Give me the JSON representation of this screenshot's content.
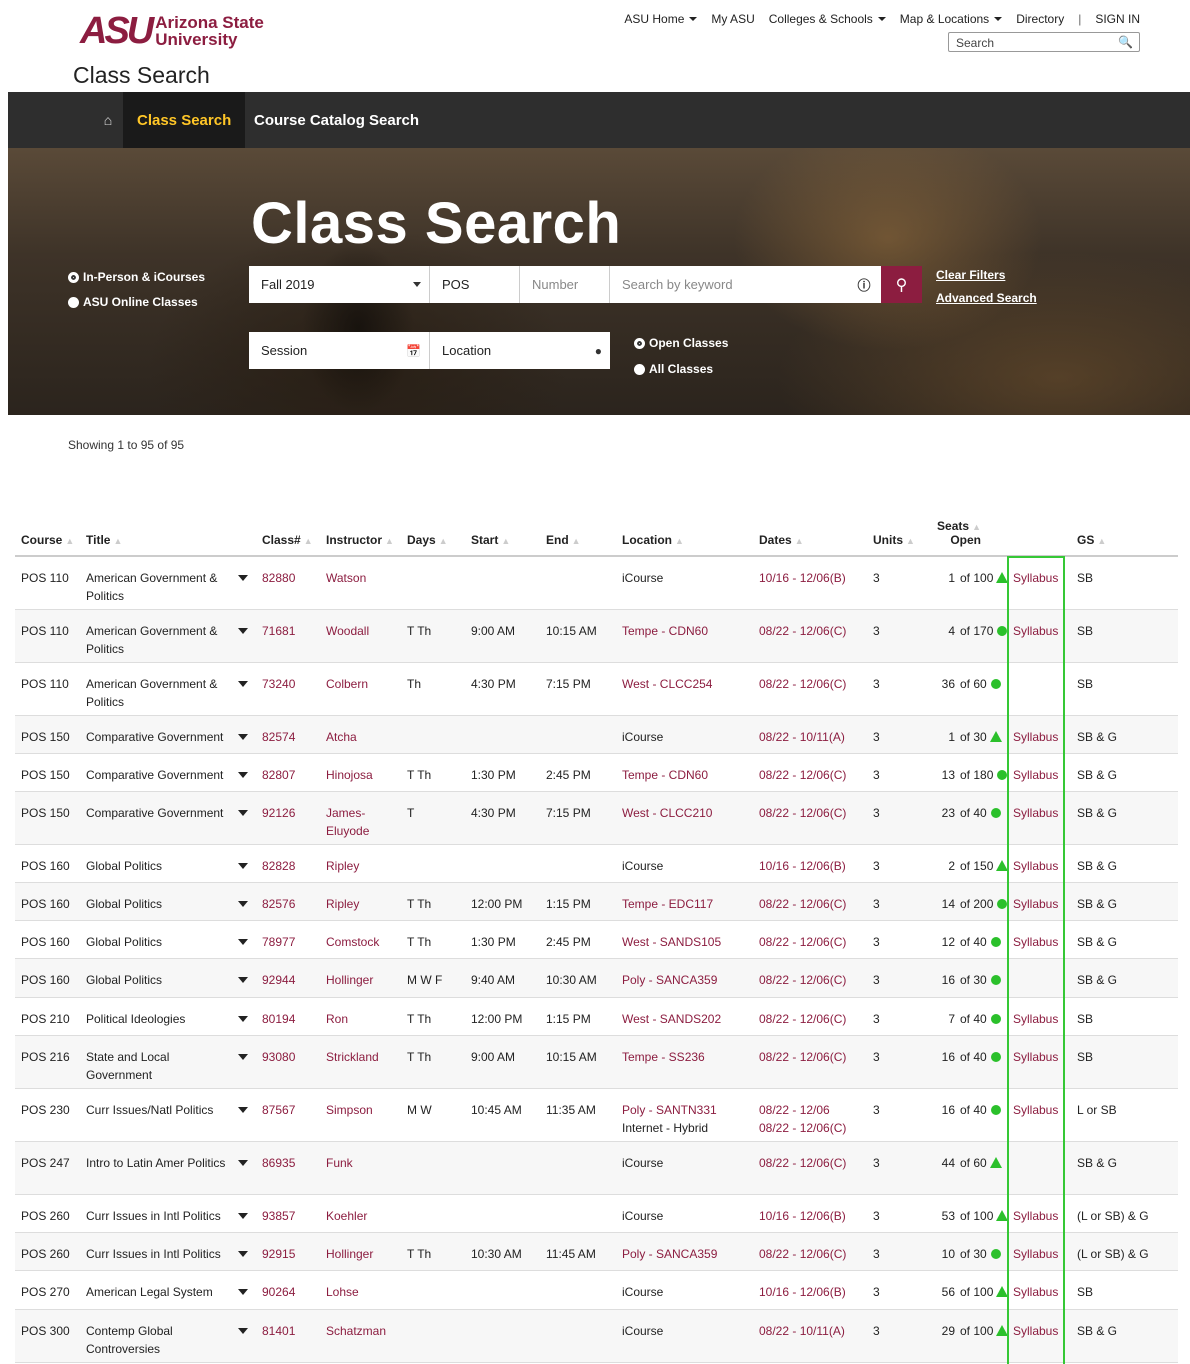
{
  "header": {
    "logo_mark": "ASU",
    "logo_line1": "Arizona State",
    "logo_line2": "University",
    "page_title": "Class Search",
    "global_nav": [
      {
        "label": "ASU Home",
        "dropdown": true
      },
      {
        "label": "My ASU",
        "dropdown": false
      },
      {
        "label": "Colleges & Schools",
        "dropdown": true
      },
      {
        "label": "Map & Locations",
        "dropdown": true
      },
      {
        "label": "Directory",
        "dropdown": false
      }
    ],
    "sign_in": "SIGN IN",
    "search_placeholder": "Search"
  },
  "main_nav": {
    "home_icon": "home-icon",
    "tabs": [
      "Class Search",
      "Course Catalog Search"
    ],
    "active_tab": "Class Search"
  },
  "hero": {
    "title": "Class Search",
    "modes": [
      "In-Person & iCourses",
      "ASU Online Classes"
    ],
    "mode_selected": "In-Person & iCourses",
    "term": "Fall 2019",
    "subject": "POS",
    "number_placeholder": "Number",
    "keyword_placeholder": "Search by keyword",
    "session_placeholder": "Session",
    "location_placeholder": "Location",
    "availability": [
      "Open Classes",
      "All Classes"
    ],
    "availability_selected": "Open Classes",
    "clear_filters": "Clear Filters",
    "advanced_search": "Advanced Search",
    "colors": {
      "maroon": "#8c1d40",
      "gold": "#ffc627"
    }
  },
  "results": {
    "showing": "Showing 1 to 95 of 95",
    "columns": [
      "Course",
      "Title",
      "Class#",
      "Instructor",
      "Days",
      "Start",
      "End",
      "Location",
      "Dates",
      "Units",
      "Seats Open",
      "",
      "GS"
    ],
    "seats_header_line1": "Seats",
    "seats_header_line2": "Open",
    "rows": [
      {
        "course": "POS 110",
        "title": "American Government & Politics",
        "class": "82880",
        "instructor": "Watson",
        "days": "",
        "start": "",
        "end": "",
        "location": "iCourse",
        "location_maroon": false,
        "dates": "10/16 - 12/06(B)",
        "units": "3",
        "seats": "1",
        "of": "of 100",
        "status": "triangle",
        "syllabus": "Syllabus",
        "gs": "SB"
      },
      {
        "course": "POS 110",
        "title": "American Government & Politics",
        "class": "71681",
        "instructor": "Woodall",
        "days": "T Th",
        "start": "9:00 AM",
        "end": "10:15 AM",
        "location": "Tempe - CDN60",
        "location_maroon": true,
        "dates": "08/22 - 12/06(C)",
        "units": "3",
        "seats": "4",
        "of": "of 170",
        "status": "dot",
        "syllabus": "Syllabus",
        "gs": "SB"
      },
      {
        "course": "POS 110",
        "title": "American Government & Politics",
        "class": "73240",
        "instructor": "Colbern",
        "days": "Th",
        "start": "4:30 PM",
        "end": "7:15 PM",
        "location": "West - CLCC254",
        "location_maroon": true,
        "dates": "08/22 - 12/06(C)",
        "units": "3",
        "seats": "36",
        "of": "of 60",
        "status": "dot",
        "syllabus": "",
        "gs": "SB"
      },
      {
        "course": "POS 150",
        "title": "Comparative Government",
        "class": "82574",
        "instructor": "Atcha",
        "days": "",
        "start": "",
        "end": "",
        "location": "iCourse",
        "location_maroon": false,
        "dates": "08/22 - 10/11(A)",
        "units": "3",
        "seats": "1",
        "of": "of 30",
        "status": "triangle",
        "syllabus": "Syllabus",
        "gs": "SB & G"
      },
      {
        "course": "POS 150",
        "title": "Comparative Government",
        "class": "82807",
        "instructor": "Hinojosa",
        "days": "T Th",
        "start": "1:30 PM",
        "end": "2:45 PM",
        "location": "Tempe - CDN60",
        "location_maroon": true,
        "dates": "08/22 - 12/06(C)",
        "units": "3",
        "seats": "13",
        "of": "of 180",
        "status": "dot",
        "syllabus": "Syllabus",
        "gs": "SB & G"
      },
      {
        "course": "POS 150",
        "title": "Comparative Government",
        "class": "92126",
        "instructor": "James-Eluyode",
        "days": "T",
        "start": "4:30 PM",
        "end": "7:15 PM",
        "location": "West - CLCC210",
        "location_maroon": true,
        "dates": "08/22 - 12/06(C)",
        "units": "3",
        "seats": "23",
        "of": "of 40",
        "status": "dot",
        "syllabus": "Syllabus",
        "gs": "SB & G"
      },
      {
        "course": "POS 160",
        "title": "Global Politics",
        "class": "82828",
        "instructor": "Ripley",
        "days": "",
        "start": "",
        "end": "",
        "location": "iCourse",
        "location_maroon": false,
        "dates": "10/16 - 12/06(B)",
        "units": "3",
        "seats": "2",
        "of": "of 150",
        "status": "triangle",
        "syllabus": "Syllabus",
        "gs": "SB & G"
      },
      {
        "course": "POS 160",
        "title": "Global Politics",
        "class": "82576",
        "instructor": "Ripley",
        "days": "T Th",
        "start": "12:00 PM",
        "end": "1:15 PM",
        "location": "Tempe - EDC117",
        "location_maroon": true,
        "dates": "08/22 - 12/06(C)",
        "units": "3",
        "seats": "14",
        "of": "of 200",
        "status": "dot",
        "syllabus": "Syllabus",
        "gs": "SB & G"
      },
      {
        "course": "POS 160",
        "title": "Global Politics",
        "class": "78977",
        "instructor": "Comstock",
        "days": "T Th",
        "start": "1:30 PM",
        "end": "2:45 PM",
        "location": "West - SANDS105",
        "location_maroon": true,
        "dates": "08/22 - 12/06(C)",
        "units": "3",
        "seats": "12",
        "of": "of 40",
        "status": "dot",
        "syllabus": "Syllabus",
        "gs": "SB & G"
      },
      {
        "course": "POS 160",
        "title": "Global Politics",
        "class": "92944",
        "instructor": "Hollinger",
        "days": "M W F",
        "start": "9:40 AM",
        "end": "10:30 AM",
        "location": "Poly - SANCA359",
        "location_maroon": true,
        "dates": "08/22 - 12/06(C)",
        "units": "3",
        "seats": "16",
        "of": "of 30",
        "status": "dot",
        "syllabus": "",
        "gs": "SB & G"
      },
      {
        "course": "POS 210",
        "title": "Political Ideologies",
        "class": "80194",
        "instructor": "Ron",
        "days": "T Th",
        "start": "12:00 PM",
        "end": "1:15 PM",
        "location": "West - SANDS202",
        "location_maroon": true,
        "dates": "08/22 - 12/06(C)",
        "units": "3",
        "seats": "7",
        "of": "of 40",
        "status": "dot",
        "syllabus": "Syllabus",
        "gs": "SB"
      },
      {
        "course": "POS 216",
        "title": "State and Local Government",
        "class": "93080",
        "instructor": "Strickland",
        "days": "T Th",
        "start": "9:00 AM",
        "end": "10:15 AM",
        "location": "Tempe - SS236",
        "location_maroon": true,
        "dates": "08/22 - 12/06(C)",
        "units": "3",
        "seats": "16",
        "of": "of 40",
        "status": "dot",
        "syllabus": "Syllabus",
        "gs": "SB"
      },
      {
        "course": "POS 230",
        "title": "Curr Issues/Natl Politics",
        "class": "87567",
        "instructor": "Simpson",
        "days": "M W",
        "start": "10:45 AM",
        "end": "11:35 AM",
        "location": "Poly - SANTN331",
        "location_maroon": true,
        "location2": "Internet - Hybrid",
        "dates": "08/22 - 12/06",
        "dates2": "08/22 - 12/06(C)",
        "units": "3",
        "seats": "16",
        "of": "of 40",
        "status": "dot",
        "syllabus": "Syllabus",
        "gs": "L or SB"
      },
      {
        "course": "POS 247",
        "title": "Intro to Latin Amer Politics",
        "class": "86935",
        "instructor": "Funk",
        "days": "",
        "start": "",
        "end": "",
        "location": "iCourse",
        "location_maroon": false,
        "dates": "08/22 - 12/06(C)",
        "units": "3",
        "seats": "44",
        "of": "of 60",
        "status": "triangle",
        "syllabus": "",
        "gs": "SB & G"
      },
      {
        "course": "POS 260",
        "title": "Curr Issues in Intl Politics",
        "class": "93857",
        "instructor": "Koehler",
        "days": "",
        "start": "",
        "end": "",
        "location": "iCourse",
        "location_maroon": false,
        "dates": "10/16 - 12/06(B)",
        "units": "3",
        "seats": "53",
        "of": "of 100",
        "status": "triangle",
        "syllabus": "Syllabus",
        "gs": "(L or SB) & G"
      },
      {
        "course": "POS 260",
        "title": "Curr Issues in Intl Politics",
        "class": "92915",
        "instructor": "Hollinger",
        "days": "T Th",
        "start": "10:30 AM",
        "end": "11:45 AM",
        "location": "Poly - SANCA359",
        "location_maroon": true,
        "dates": "08/22 - 12/06(C)",
        "units": "3",
        "seats": "10",
        "of": "of 30",
        "status": "dot",
        "syllabus": "Syllabus",
        "gs": "(L or SB) & G"
      },
      {
        "course": "POS 270",
        "title": "American Legal System",
        "class": "90264",
        "instructor": "Lohse",
        "days": "",
        "start": "",
        "end": "",
        "location": "iCourse",
        "location_maroon": false,
        "dates": "10/16 - 12/06(B)",
        "units": "3",
        "seats": "56",
        "of": "of 100",
        "status": "triangle",
        "syllabus": "Syllabus",
        "gs": "SB"
      },
      {
        "course": "POS 300",
        "title": "Contemp Global Controversies",
        "class": "81401",
        "instructor": "Schatzman",
        "days": "",
        "start": "",
        "end": "",
        "location": "iCourse",
        "location_maroon": false,
        "dates": "08/22 - 10/11(A)",
        "units": "3",
        "seats": "29",
        "of": "of 100",
        "status": "triangle",
        "syllabus": "Syllabus",
        "gs": "SB & G"
      }
    ]
  }
}
